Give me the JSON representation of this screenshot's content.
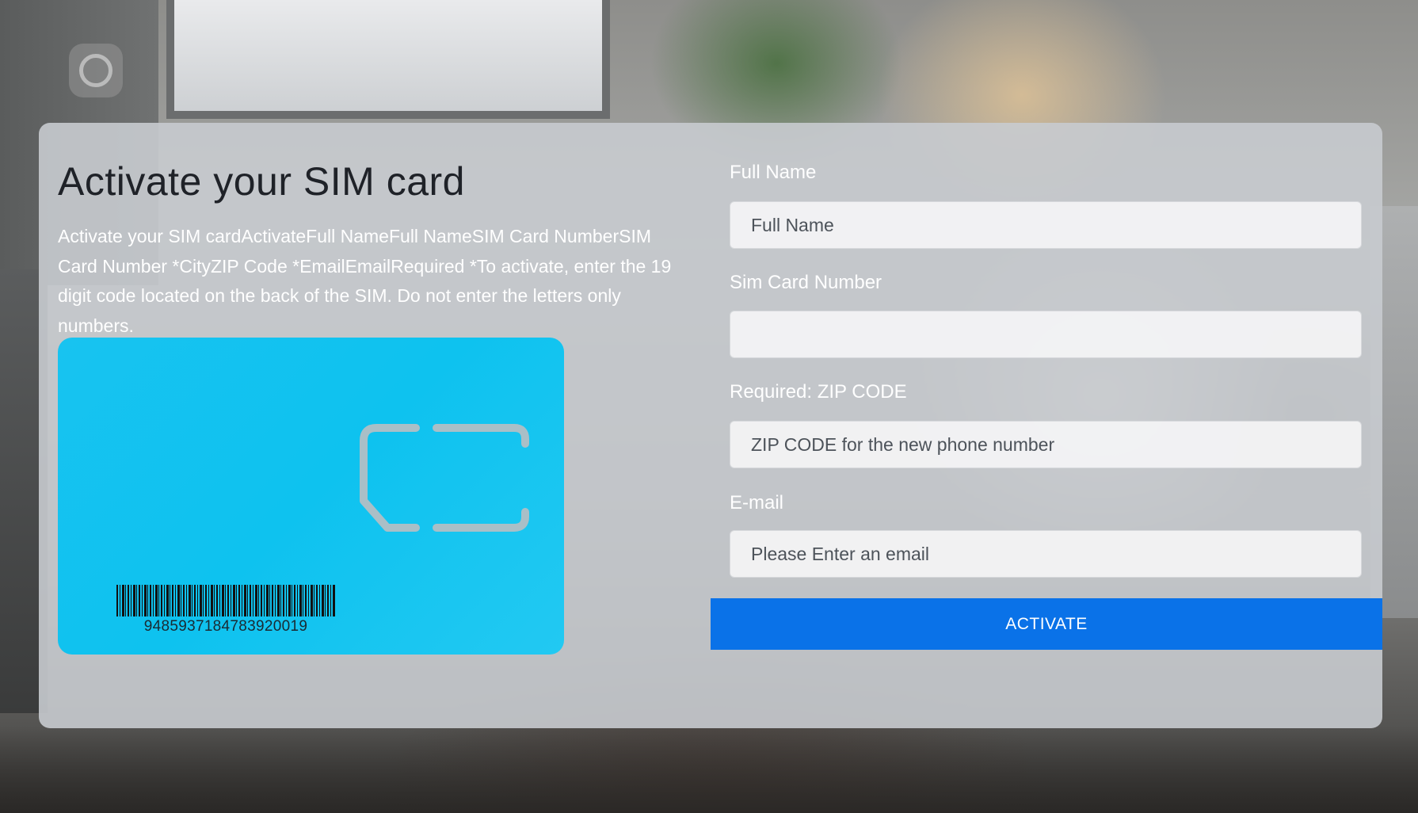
{
  "page": {
    "title": "Activate your SIM card",
    "description": "Activate your SIM cardActivateFull NameFull NameSIM Card NumberSIM Card Number *CityZIP Code *EmailEmailRequired *To activate, enter the 19 digit code located on the back of the SIM. Do not enter the letters only numbers."
  },
  "sim_card": {
    "barcode_number": "9485937184783920019",
    "color": "#12c3f0"
  },
  "form": {
    "full_name": {
      "label": "Full Name",
      "placeholder": "Full Name",
      "value": ""
    },
    "sim_number": {
      "label": "Sim Card Number",
      "placeholder": "",
      "value": ""
    },
    "zip": {
      "label": "Required: ZIP CODE",
      "placeholder": "ZIP CODE for the new phone number",
      "value": ""
    },
    "email": {
      "label": "E-mail",
      "placeholder": "Please Enter an email",
      "value": ""
    },
    "submit_label": "ACTIVATE"
  },
  "colors": {
    "accent": "#0a72e8",
    "panel": "#c8cbcf"
  },
  "icons": {
    "logo": "ring-logo-icon",
    "chip": "sim-chip-icon",
    "barcode": "barcode-icon"
  }
}
